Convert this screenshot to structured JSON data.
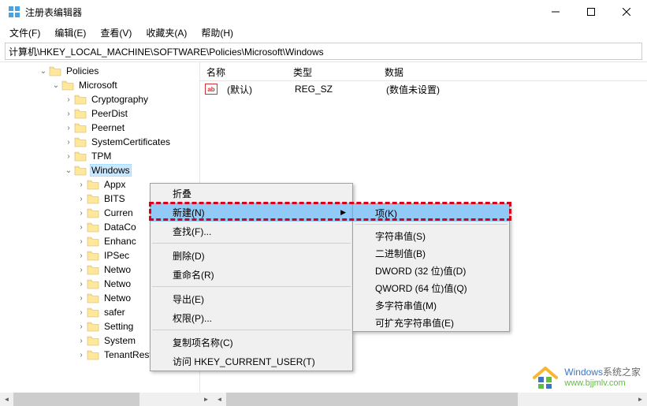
{
  "window": {
    "title": "注册表编辑器"
  },
  "menu": {
    "file": "文件(F)",
    "edit": "编辑(E)",
    "view": "查看(V)",
    "fav": "收藏夹(A)",
    "help": "帮助(H)"
  },
  "address": "计算机\\HKEY_LOCAL_MACHINE\\SOFTWARE\\Policies\\Microsoft\\Windows",
  "tree": {
    "policies": "Policies",
    "microsoft": "Microsoft",
    "children": [
      "Cryptography",
      "PeerDist",
      "Peernet",
      "SystemCertificates",
      "TPM",
      "Windows"
    ],
    "windows_children": [
      "Appx",
      "BITS",
      "Curren",
      "DataCo",
      "Enhanc",
      "IPSec",
      "Netwo",
      "Netwo",
      "Netwo",
      "safer",
      "Setting",
      "System",
      "TenantRestriction"
    ]
  },
  "list": {
    "headers": {
      "name": "名称",
      "type": "类型",
      "data": "数据"
    },
    "row": {
      "name": "(默认)",
      "type": "REG_SZ",
      "data": "(数值未设置)"
    }
  },
  "ctx1": {
    "collapse": "折叠",
    "new": "新建(N)",
    "find": "查找(F)...",
    "delete": "删除(D)",
    "rename": "重命名(R)",
    "export": "导出(E)",
    "perm": "权限(P)...",
    "copyname": "复制项名称(C)",
    "goto": "访问 HKEY_CURRENT_USER(T)"
  },
  "ctx2": {
    "key": "项(K)",
    "string": "字符串值(S)",
    "binary": "二进制值(B)",
    "dword": "DWORD (32 位)值(D)",
    "qword": "QWORD (64 位)值(Q)",
    "multi": "多字符串值(M)",
    "expand": "可扩充字符串值(E)"
  },
  "watermark": {
    "brand": "Windows",
    "brand2": "系统之家",
    "url": "www.bjjmlv.com"
  }
}
